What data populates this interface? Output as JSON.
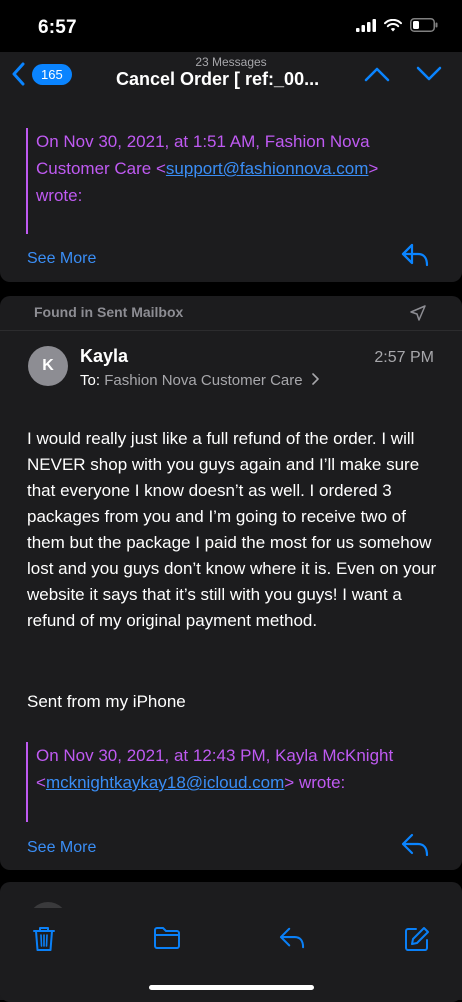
{
  "status": {
    "time": "6:57"
  },
  "nav": {
    "badge": "165",
    "message_count": "23 Messages",
    "subject": "Cancel Order    [ ref:_00..."
  },
  "quoted1": {
    "line1": "On Nov 30, 2021, at 1:51 AM, Fashion Nova",
    "line2_pre": "Customer Care <",
    "link": "support@fashionnova.com",
    "line2_post": ">",
    "line3": "wrote:",
    "see_more": "See More"
  },
  "message": {
    "found_in": "Found in Sent Mailbox",
    "avatar_initial": "K",
    "sender": "Kayla",
    "time": "2:57 PM",
    "to_label": "To:",
    "to_value": "Fashion Nova Customer Care",
    "body": "I would really just like a full refund of the order. I will NEVER shop with you guys again and I’ll make sure that everyone I know doesn’t as well. I ordered 3 packages from you and I’m going to receive two of them but the package I paid the most for us somehow lost and you guys don’t know where it is. Even on your website it says that it’s still with you guys! I want a refund of my original payment method.",
    "signature": "Sent from my iPhone",
    "quote_line1": "On Nov 30, 2021, at 12:43 PM, Kayla McKnight",
    "quote_pre": "<",
    "quote_link": "mcknightkaykay18@icloud.com",
    "quote_post": "> wrote:",
    "see_more": "See More"
  },
  "icons": {
    "back": "chevron-left-icon",
    "up": "chevron-up-icon",
    "down": "chevron-down-icon",
    "reply": "reply-icon",
    "trash": "trash-icon",
    "folder": "folder-icon",
    "compose": "compose-icon",
    "sent": "paper-plane-icon"
  },
  "colors": {
    "accent": "#0a84ff",
    "quote": "#bf5af2",
    "link": "#3a8ef6"
  }
}
